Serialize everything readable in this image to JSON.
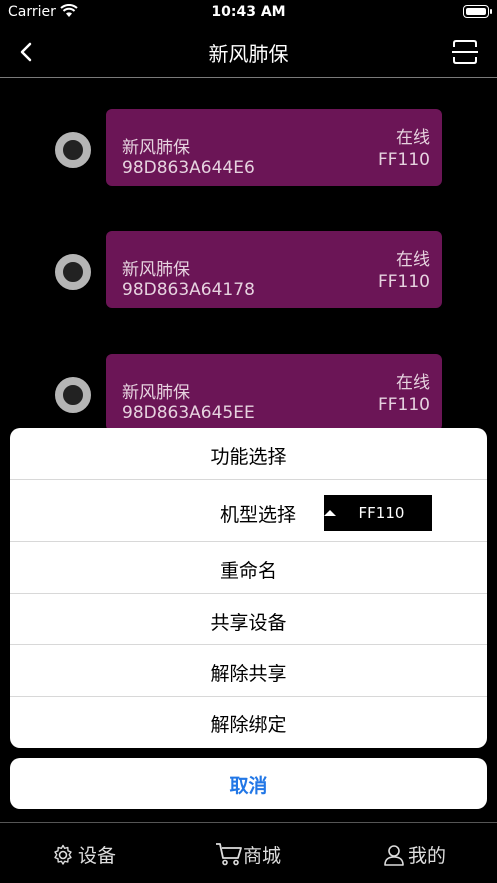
{
  "status_bar": {
    "carrier": "Carrier",
    "time": "10:43 AM"
  },
  "nav": {
    "title": "新风肺保",
    "back_icon": "chevron-left-icon",
    "scan_icon": "scan-icon"
  },
  "devices": [
    {
      "name": "新风肺保",
      "mac": "98D863A644E6",
      "status": "在线",
      "model": "FF110"
    },
    {
      "name": "新风肺保",
      "mac": "98D863A64178",
      "status": "在线",
      "model": "FF110"
    },
    {
      "name": "新风肺保",
      "mac": "98D863A645EE",
      "status": "在线",
      "model": "FF110"
    }
  ],
  "sheet": {
    "title": "功能选择",
    "model_label": "机型选择",
    "model_value": "FF110",
    "rename": "重命名",
    "share": "共享设备",
    "unshare": "解除共享",
    "unbind": "解除绑定",
    "cancel": "取消"
  },
  "tabs": [
    {
      "label": "设备",
      "icon": "gear-icon"
    },
    {
      "label": "商城",
      "icon": "cart-icon"
    },
    {
      "label": "我的",
      "icon": "user-icon"
    }
  ],
  "colors": {
    "card": "#6b1556",
    "cancel_text": "#2277e6"
  }
}
